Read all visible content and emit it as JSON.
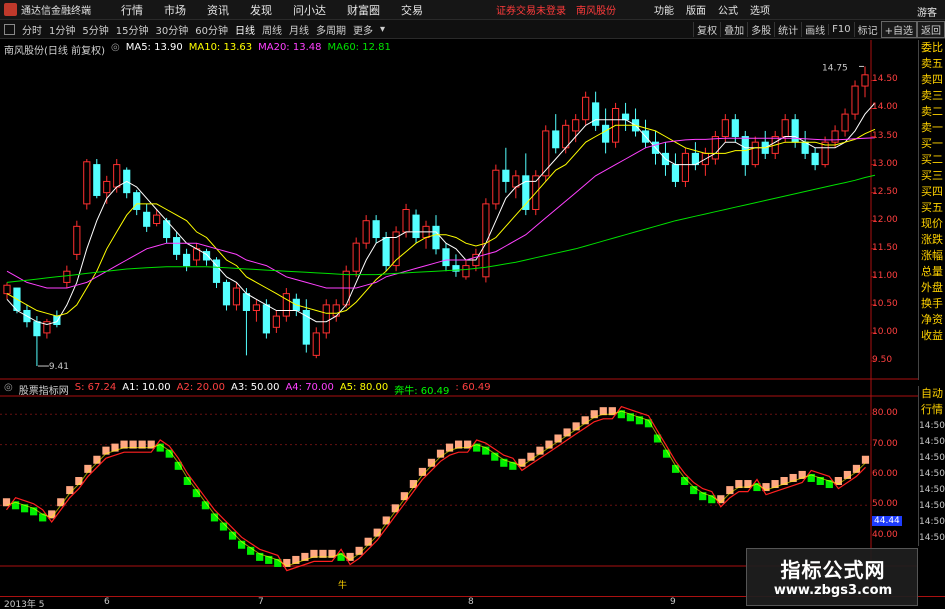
{
  "app": {
    "title": "通达信金融终端",
    "menu": [
      "行情",
      "市场",
      "资讯",
      "发现",
      "问小达",
      "财富圈",
      "交易"
    ],
    "login_status": "证券交易未登录",
    "stock_name": "南风股份",
    "right_menu": [
      "功能",
      "版面",
      "公式",
      "选项"
    ],
    "guest": "游客"
  },
  "periods": {
    "items": [
      "分时",
      "1分钟",
      "5分钟",
      "15分钟",
      "30分钟",
      "60分钟",
      "日线",
      "周线",
      "月线",
      "多周期",
      "更多"
    ],
    "active": "日线"
  },
  "toolbar": {
    "items": [
      "复权",
      "叠加",
      "多股",
      "统计",
      "画线",
      "F10",
      "标记",
      "+自选",
      "返回"
    ]
  },
  "main_legend": {
    "title": "南风股份(日线 前复权)",
    "ma5": "MA5: 13.90",
    "ma10": "MA10: 13.63",
    "ma20": "MA20: 13.48",
    "ma60": "MA60: 12.81",
    "colors": {
      "ma5": "#ffffff",
      "ma10": "#ffff00",
      "ma20": "#ff40ff",
      "ma60": "#00e000"
    }
  },
  "price_labels": {
    "high": "14.75",
    "low": "9.41"
  },
  "price_axis": [
    "14.50",
    "14.00",
    "13.50",
    "13.00",
    "12.50",
    "12.00",
    "11.50",
    "11.00",
    "10.50",
    "10.00",
    "9.50"
  ],
  "sidebar_main": [
    "委比",
    "卖五",
    "卖四",
    "卖三",
    "卖二",
    "卖一",
    "买一",
    "买二",
    "买三",
    "买四",
    "买五",
    "现价",
    "涨跌",
    "涨幅",
    "总量",
    "外盘",
    "换手",
    "净资",
    "收益"
  ],
  "sidebar_ind": [
    "自动",
    "行情",
    "14:50",
    "14:50",
    "14:50",
    "14:50",
    "14:50",
    "14:50",
    "14:50",
    "14:50"
  ],
  "ind_legend": {
    "title": "股票指标网",
    "items": [
      {
        "text": "S: 67.24",
        "color": "#ff4040"
      },
      {
        "text": "A1: 10.00",
        "color": "#ffffff"
      },
      {
        "text": "A2: 20.00",
        "color": "#ff4040"
      },
      {
        "text": "A3: 50.00",
        "color": "#ffffff"
      },
      {
        "text": "A4: 70.00",
        "color": "#ff40ff"
      },
      {
        "text": "A5: 80.00",
        "color": "#ffff00"
      },
      {
        "text": "奔牛: 60.49",
        "color": "#00ff00"
      },
      {
        "text": ": 60.49",
        "color": "#ff4040"
      }
    ]
  },
  "ind_axis": [
    "80.00",
    "70.00",
    "60.00",
    "50.00",
    "40.00"
  ],
  "ind_current": "44.44",
  "bottom_marker": "牛",
  "dates": [
    "2013年 5",
    "6",
    "7",
    "8",
    "9"
  ],
  "watermark": {
    "title": "指标公式网",
    "url": "www.zbgs3.com"
  },
  "chart_data": [
    {
      "type": "candlestick",
      "title": "南风股份(日线 前复权)",
      "ylim": [
        9.25,
        14.9
      ],
      "high_mark": 14.75,
      "low_mark": 9.41,
      "candles": [
        [
          10.7,
          10.9,
          10.6,
          10.85
        ],
        [
          10.8,
          10.8,
          10.35,
          10.4
        ],
        [
          10.4,
          10.5,
          10.1,
          10.2
        ],
        [
          10.2,
          10.3,
          9.41,
          9.95
        ],
        [
          10.0,
          10.25,
          9.9,
          10.2
        ],
        [
          10.3,
          10.4,
          10.1,
          10.15
        ],
        [
          10.9,
          11.2,
          10.8,
          11.1
        ],
        [
          11.4,
          12.0,
          11.3,
          11.9
        ],
        [
          12.3,
          13.1,
          12.2,
          13.05
        ],
        [
          13.0,
          13.1,
          12.4,
          12.45
        ],
        [
          12.5,
          12.8,
          12.3,
          12.7
        ],
        [
          12.6,
          13.1,
          12.5,
          13.0
        ],
        [
          12.9,
          12.95,
          12.4,
          12.5
        ],
        [
          12.5,
          12.55,
          12.1,
          12.2
        ],
        [
          12.15,
          12.3,
          11.8,
          11.9
        ],
        [
          11.95,
          12.2,
          11.9,
          12.1
        ],
        [
          12.0,
          12.05,
          11.6,
          11.7
        ],
        [
          11.7,
          11.8,
          11.3,
          11.4
        ],
        [
          11.4,
          11.5,
          11.1,
          11.2
        ],
        [
          11.3,
          11.6,
          11.2,
          11.5
        ],
        [
          11.45,
          11.5,
          11.2,
          11.3
        ],
        [
          11.3,
          11.35,
          10.8,
          10.9
        ],
        [
          10.9,
          10.95,
          10.4,
          10.5
        ],
        [
          10.5,
          10.9,
          10.4,
          10.8
        ],
        [
          10.7,
          10.8,
          9.6,
          10.4
        ],
        [
          10.4,
          10.6,
          10.2,
          10.5
        ],
        [
          10.5,
          10.6,
          9.9,
          10.0
        ],
        [
          10.1,
          10.4,
          10.0,
          10.3
        ],
        [
          10.3,
          10.8,
          10.2,
          10.7
        ],
        [
          10.6,
          10.7,
          10.3,
          10.4
        ],
        [
          10.4,
          10.6,
          9.65,
          9.8
        ],
        [
          9.6,
          10.1,
          9.55,
          10.0
        ],
        [
          10.0,
          10.6,
          9.9,
          10.5
        ],
        [
          10.3,
          10.6,
          10.2,
          10.5
        ],
        [
          10.5,
          11.2,
          10.45,
          11.1
        ],
        [
          11.1,
          11.7,
          11.0,
          11.6
        ],
        [
          11.6,
          12.1,
          11.5,
          12.0
        ],
        [
          12.0,
          12.1,
          11.6,
          11.7
        ],
        [
          11.7,
          11.8,
          11.1,
          11.2
        ],
        [
          11.2,
          11.9,
          11.1,
          11.8
        ],
        [
          11.8,
          12.3,
          11.7,
          12.2
        ],
        [
          12.1,
          12.2,
          11.6,
          11.7
        ],
        [
          11.7,
          12.0,
          11.5,
          11.9
        ],
        [
          11.9,
          12.1,
          11.4,
          11.5
        ],
        [
          11.5,
          11.6,
          11.1,
          11.2
        ],
        [
          11.2,
          11.4,
          11.0,
          11.1
        ],
        [
          11.0,
          11.3,
          10.95,
          11.2
        ],
        [
          11.2,
          11.5,
          11.1,
          11.4
        ],
        [
          11.0,
          12.4,
          10.9,
          12.3
        ],
        [
          12.3,
          13.0,
          12.2,
          12.9
        ],
        [
          12.9,
          13.3,
          12.5,
          12.7
        ],
        [
          12.6,
          12.9,
          12.4,
          12.8
        ],
        [
          12.8,
          13.2,
          12.1,
          12.2
        ],
        [
          12.2,
          12.9,
          12.1,
          12.8
        ],
        [
          12.8,
          13.7,
          12.7,
          13.6
        ],
        [
          13.6,
          13.9,
          13.2,
          13.3
        ],
        [
          13.3,
          13.8,
          13.2,
          13.7
        ],
        [
          13.6,
          13.9,
          13.4,
          13.8
        ],
        [
          13.8,
          14.3,
          13.7,
          14.2
        ],
        [
          14.1,
          14.3,
          13.6,
          13.7
        ],
        [
          13.7,
          14.0,
          13.2,
          13.4
        ],
        [
          13.4,
          14.1,
          13.3,
          14.0
        ],
        [
          13.9,
          14.1,
          13.6,
          13.8
        ],
        [
          13.8,
          14.0,
          13.5,
          13.6
        ],
        [
          13.6,
          13.8,
          13.3,
          13.4
        ],
        [
          13.4,
          13.6,
          13.0,
          13.2
        ],
        [
          13.2,
          13.4,
          12.8,
          13.0
        ],
        [
          13.0,
          13.2,
          12.6,
          12.7
        ],
        [
          12.7,
          13.3,
          12.6,
          13.2
        ],
        [
          13.2,
          13.4,
          12.9,
          13.0
        ],
        [
          13.0,
          13.3,
          12.8,
          13.2
        ],
        [
          13.1,
          13.6,
          13.0,
          13.5
        ],
        [
          13.5,
          13.9,
          13.4,
          13.8
        ],
        [
          13.8,
          13.9,
          13.4,
          13.5
        ],
        [
          13.5,
          13.6,
          12.8,
          13.0
        ],
        [
          13.0,
          13.5,
          12.95,
          13.4
        ],
        [
          13.4,
          13.6,
          13.1,
          13.2
        ],
        [
          13.2,
          13.6,
          13.1,
          13.5
        ],
        [
          13.5,
          13.9,
          13.4,
          13.8
        ],
        [
          13.8,
          13.9,
          13.3,
          13.4
        ],
        [
          13.4,
          13.6,
          13.1,
          13.2
        ],
        [
          13.2,
          13.3,
          12.9,
          13.0
        ],
        [
          13.0,
          13.5,
          12.95,
          13.4
        ],
        [
          13.4,
          13.7,
          13.3,
          13.6
        ],
        [
          13.6,
          14.0,
          13.5,
          13.9
        ],
        [
          13.9,
          14.5,
          13.8,
          14.4
        ],
        [
          14.4,
          14.75,
          14.2,
          14.6
        ]
      ],
      "ma5": [
        10.6,
        10.4,
        10.3,
        10.2,
        10.15,
        10.2,
        10.5,
        10.9,
        11.5,
        12.0,
        12.4,
        12.6,
        12.7,
        12.6,
        12.4,
        12.2,
        12.0,
        11.8,
        11.6,
        11.5,
        11.4,
        11.2,
        11.0,
        10.9,
        10.7,
        10.6,
        10.5,
        10.4,
        10.4,
        10.4,
        10.3,
        10.2,
        10.2,
        10.3,
        10.5,
        10.9,
        11.3,
        11.6,
        11.7,
        11.7,
        11.8,
        11.8,
        11.8,
        11.8,
        11.6,
        11.5,
        11.3,
        11.3,
        11.6,
        12.0,
        12.4,
        12.6,
        12.7,
        12.7,
        12.9,
        13.1,
        13.3,
        13.5,
        13.7,
        13.8,
        13.8,
        13.8,
        13.8,
        13.7,
        13.5,
        13.3,
        13.1,
        13.0,
        13.0,
        13.0,
        13.1,
        13.2,
        13.4,
        13.4,
        13.3,
        13.3,
        13.3,
        13.4,
        13.5,
        13.5,
        13.4,
        13.3,
        13.3,
        13.3,
        13.4,
        13.6,
        13.9,
        14.1
      ],
      "ma10": [
        10.7,
        10.6,
        10.5,
        10.4,
        10.35,
        10.3,
        10.35,
        10.5,
        10.8,
        11.1,
        11.5,
        11.8,
        12.1,
        12.3,
        12.3,
        12.3,
        12.2,
        12.1,
        12.0,
        11.8,
        11.7,
        11.5,
        11.3,
        11.2,
        11.0,
        10.9,
        10.8,
        10.7,
        10.6,
        10.5,
        10.45,
        10.4,
        10.35,
        10.35,
        10.4,
        10.55,
        10.75,
        10.95,
        11.1,
        11.3,
        11.45,
        11.6,
        11.7,
        11.75,
        11.75,
        11.7,
        11.6,
        11.55,
        11.6,
        11.7,
        11.9,
        12.1,
        12.3,
        12.5,
        12.7,
        12.9,
        13.0,
        13.2,
        13.4,
        13.5,
        13.6,
        13.7,
        13.7,
        13.7,
        13.65,
        13.6,
        13.5,
        13.4,
        13.3,
        13.25,
        13.2,
        13.2,
        13.2,
        13.25,
        13.25,
        13.3,
        13.3,
        13.35,
        13.4,
        13.4,
        13.4,
        13.4,
        13.35,
        13.35,
        13.4,
        13.45,
        13.55,
        13.63
      ],
      "ma20": [
        11.1,
        11.0,
        10.9,
        10.85,
        10.8,
        10.8,
        10.8,
        10.85,
        10.9,
        11.0,
        11.1,
        11.2,
        11.3,
        11.4,
        11.5,
        11.55,
        11.6,
        11.6,
        11.6,
        11.6,
        11.55,
        11.5,
        11.45,
        11.4,
        11.3,
        11.25,
        11.2,
        11.1,
        11.0,
        10.95,
        10.9,
        10.85,
        10.8,
        10.8,
        10.8,
        10.8,
        10.85,
        10.9,
        11.0,
        11.05,
        11.1,
        11.15,
        11.2,
        11.25,
        11.3,
        11.3,
        11.3,
        11.35,
        11.4,
        11.45,
        11.55,
        11.65,
        11.75,
        11.9,
        12.05,
        12.2,
        12.35,
        12.5,
        12.65,
        12.8,
        12.9,
        13.0,
        13.1,
        13.2,
        13.3,
        13.35,
        13.4,
        13.42,
        13.44,
        13.45,
        13.45,
        13.46,
        13.47,
        13.47,
        13.47,
        13.47,
        13.47,
        13.47,
        13.47,
        13.47,
        13.46,
        13.45,
        13.44,
        13.44,
        13.45,
        13.46,
        13.47,
        13.48
      ],
      "ma60": [
        10.9,
        10.92,
        10.94,
        10.96,
        10.98,
        11.0,
        11.02,
        11.04,
        11.06,
        11.08,
        11.1,
        11.12,
        11.14,
        11.15,
        11.16,
        11.17,
        11.18,
        11.18,
        11.18,
        11.18,
        11.18,
        11.17,
        11.16,
        11.15,
        11.14,
        11.13,
        11.12,
        11.11,
        11.1,
        11.09,
        11.08,
        11.07,
        11.06,
        11.05,
        11.04,
        11.04,
        11.04,
        11.04,
        11.05,
        11.06,
        11.07,
        11.08,
        11.09,
        11.1,
        11.11,
        11.12,
        11.13,
        11.15,
        11.17,
        11.2,
        11.23,
        11.26,
        11.3,
        11.34,
        11.38,
        11.42,
        11.46,
        11.5,
        11.55,
        11.6,
        11.65,
        11.7,
        11.75,
        11.8,
        11.85,
        11.9,
        11.95,
        12.0,
        12.04,
        12.08,
        12.12,
        12.16,
        12.2,
        12.24,
        12.28,
        12.32,
        12.36,
        12.4,
        12.44,
        12.48,
        12.52,
        12.56,
        12.6,
        12.64,
        12.68,
        12.72,
        12.77,
        12.81
      ]
    },
    {
      "type": "indicator",
      "title": "股票指标网",
      "ylim": [
        30,
        86
      ],
      "levels": [
        80,
        70,
        50
      ],
      "current": 44.44,
      "steps": [
        51,
        50,
        49,
        48,
        46,
        47,
        51,
        55,
        58,
        62,
        65,
        68,
        69,
        70,
        70,
        70,
        70,
        69,
        67,
        63,
        58,
        54,
        50,
        46,
        43,
        40,
        37,
        35,
        33,
        32,
        31,
        31,
        32,
        33,
        34,
        34,
        34,
        33,
        33,
        35,
        38,
        41,
        45,
        49,
        53,
        57,
        61,
        64,
        67,
        69,
        70,
        70,
        69,
        68,
        66,
        64,
        63,
        64,
        66,
        68,
        70,
        72,
        74,
        76,
        78,
        80,
        81,
        81,
        80,
        79,
        78,
        77,
        72,
        67,
        62,
        58,
        55,
        53,
        52,
        52,
        55,
        57,
        57,
        56,
        56,
        57,
        58,
        59,
        60,
        59,
        58,
        57,
        58,
        60,
        62,
        65
      ]
    }
  ]
}
